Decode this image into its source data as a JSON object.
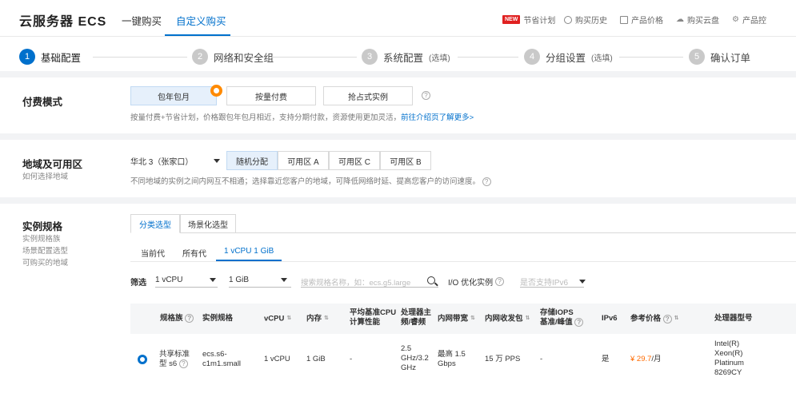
{
  "header": {
    "brand": "云服务器 ECS",
    "tabs": [
      "一键购买",
      "自定义购买"
    ],
    "links": {
      "new_badge": "NEW",
      "savings_plan": "节省计划",
      "purchase_history": "购买历史",
      "product_price": "产品价格",
      "buy_disk": "购买云盘",
      "product_more": "产品控"
    }
  },
  "steps": [
    {
      "num": "1",
      "label": "基础配置",
      "optional": ""
    },
    {
      "num": "2",
      "label": "网络和安全组",
      "optional": ""
    },
    {
      "num": "3",
      "label": "系统配置",
      "optional": "(选填)"
    },
    {
      "num": "4",
      "label": "分组设置",
      "optional": "(选填)"
    },
    {
      "num": "5",
      "label": "确认订单",
      "optional": ""
    }
  ],
  "billing": {
    "title": "付费模式",
    "options": [
      "包年包月",
      "按量付费",
      "抢占式实例"
    ],
    "hint": "按量付费+节省计划，价格跟包年包月相近，支持分期付款，资源使用更加灵活，",
    "hint_link": "前往介绍页了解更多>"
  },
  "region": {
    "title": "地域及可用区",
    "sub": "如何选择地域",
    "selected_region": "华北 3（张家口）",
    "zones": [
      "随机分配",
      "可用区 A",
      "可用区 C",
      "可用区 B"
    ],
    "hint": "不同地域的实例之间内网互不相通；选择靠近您客户的地域，可降低网络时延、提高您客户的访问速度。"
  },
  "spec": {
    "title": "实例规格",
    "subs": [
      "实例规格族",
      "场景配置选型",
      "可购买的地域"
    ],
    "tabs": [
      "分类选型",
      "场景化选型"
    ],
    "subtabs": [
      "当前代",
      "所有代",
      "1 vCPU 1 GiB"
    ],
    "filter": {
      "label": "筛选",
      "vcpu": "1 vCPU",
      "mem": "1 GiB",
      "search_placeholder": "搜索规格名称，如：ecs.g5.large",
      "io_opt": "I/O 优化实例",
      "ipv6_placeholder": "是否支持IPv6"
    },
    "table": {
      "headers": {
        "family": "规格族",
        "spec": "实例规格",
        "vcpu": "vCPU",
        "mem": "内存",
        "baseline1": "平均基准CPU",
        "baseline2": "计算性能",
        "cpu_freq1": "处理器主",
        "cpu_freq2": "频/睿频",
        "bandwidth": "内网带宽",
        "pps": "内网收发包",
        "iops1": "存储IOPS",
        "iops2": "基准/峰值",
        "ipv6": "IPv6",
        "price": "参考价格",
        "model": "处理器型号"
      },
      "row": {
        "family1": "共享标准",
        "family2": "型 s6",
        "spec1": "ecs.s6-",
        "spec2": "c1m1.small",
        "vcpu": "1 vCPU",
        "mem": "1 GiB",
        "baseline": "-",
        "freq1": "2.5",
        "freq2": "GHz/3.2",
        "freq3": "GHz",
        "bw1": "最高 1.5",
        "bw2": "Gbps",
        "pps": "15 万 PPS",
        "iops": "-",
        "ipv6": "是",
        "price": "¥ 29.7",
        "price_unit": "/月",
        "model1": "Intel(R)",
        "model2": "Xeon(R)",
        "model3": "Platinum",
        "model4": "8269CY"
      }
    }
  },
  "colors": {
    "accent": "#0070cc",
    "price": "#ff6a00",
    "badge": "#ff8a00"
  }
}
